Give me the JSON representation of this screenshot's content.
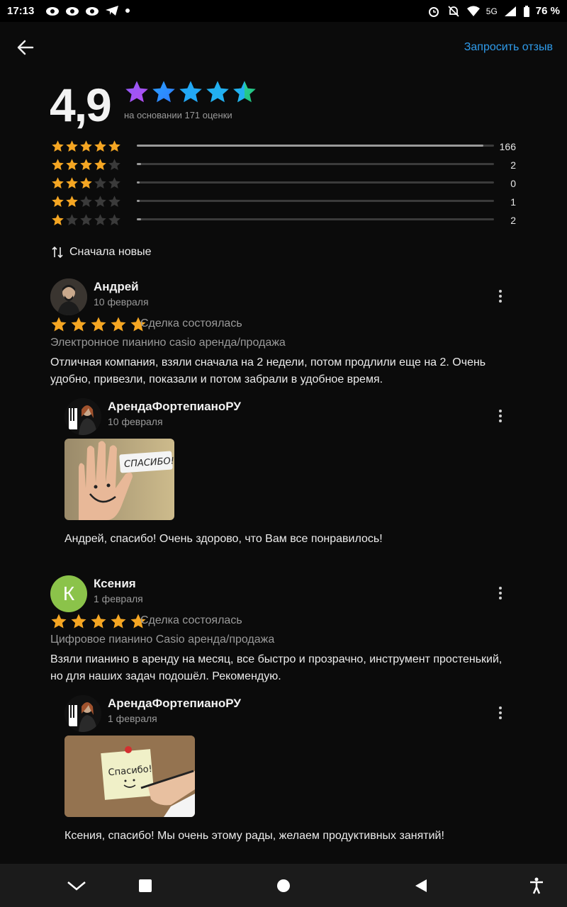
{
  "status_bar": {
    "time": "17:13",
    "network": "5G",
    "battery": "76 %"
  },
  "header": {
    "request_review": "Запросить отзыв"
  },
  "summary": {
    "rating": "4,9",
    "stars_value": 4.9,
    "basis": "на основании 171 оценки",
    "distribution": [
      {
        "stars": 5,
        "count": "166",
        "fraction": 0.97
      },
      {
        "stars": 4,
        "count": "2",
        "fraction": 0.012
      },
      {
        "stars": 3,
        "count": "0",
        "fraction": 0.0
      },
      {
        "stars": 2,
        "count": "1",
        "fraction": 0.006
      },
      {
        "stars": 1,
        "count": "2",
        "fraction": 0.012
      }
    ]
  },
  "sort": {
    "label": "Сначала новые"
  },
  "reviews": [
    {
      "author": "Андрей",
      "date": "10 февраля",
      "stars": 5,
      "deal": "Сделка состоялась",
      "product": "Электронное пианино casio аренда/продажа",
      "text": "Отличная компания, взяли сначала на 2 недели, потом продлили еще на 2. Очень удобно, привезли, показали и потом забрали в удобное время.",
      "reply": {
        "author": "АрендаФортепианоРУ",
        "date": "10 февраля",
        "image_text": "СПАСИБО!",
        "text": "Андрей, спасибо! Очень здорово, что Вам все понравилось!"
      }
    },
    {
      "author": "Ксения",
      "avatar_letter": "К",
      "date": "1 февраля",
      "stars": 5,
      "deal": "Сделка состоялась",
      "product": "Цифровое пианино Casio аренда/продажа",
      "text": "Взяли пианино в аренду на месяц, все быстро и прозрачно, инструмент простенький, но для наших задач подошёл. Рекомендую.",
      "reply": {
        "author": "АрендаФортепианоРУ",
        "date": "1 февраля",
        "image_text": "Спасибо!",
        "text": "Ксения, спасибо! Мы очень этому рады, желаем продуктивных занятий!"
      }
    }
  ],
  "colors": {
    "background": "#0b0b0b",
    "accent_link": "#2f9bea",
    "star_orange": "#f5a623",
    "star_empty": "#3a3a3a",
    "avatar_green": "#8bc34a"
  }
}
